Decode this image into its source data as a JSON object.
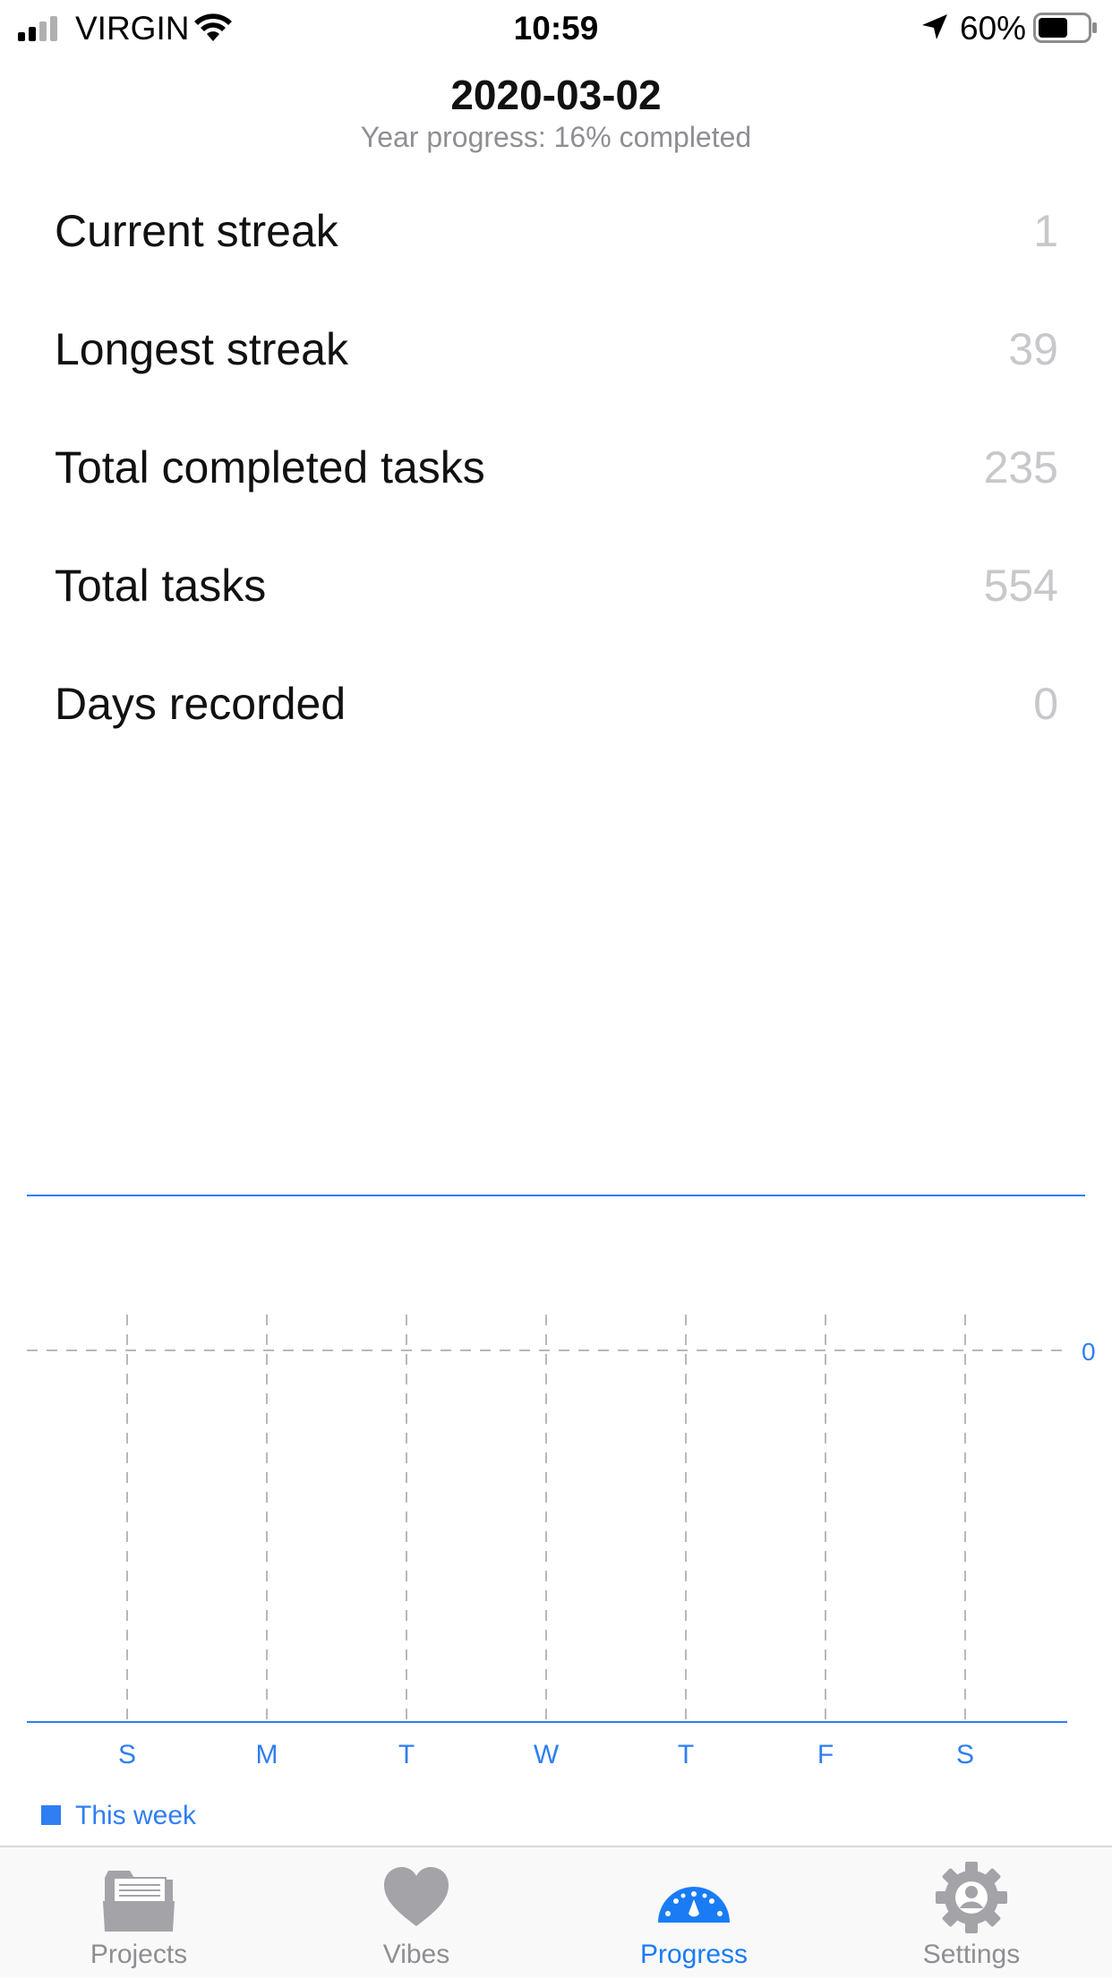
{
  "status_bar": {
    "carrier": "VIRGIN",
    "time": "10:59",
    "battery_percent": "60%",
    "battery_level": 0.6
  },
  "header": {
    "title": "2020-03-02",
    "subtitle": "Year progress: 16% completed"
  },
  "stats": [
    {
      "label": "Current streak",
      "value": "1"
    },
    {
      "label": "Longest streak",
      "value": "39"
    },
    {
      "label": "Total completed tasks",
      "value": "235"
    },
    {
      "label": "Total tasks",
      "value": "554"
    },
    {
      "label": "Days recorded",
      "value": "0"
    }
  ],
  "chart_data": {
    "type": "bar",
    "categories": [
      "S",
      "M",
      "T",
      "W",
      "T",
      "F",
      "S"
    ],
    "series": [
      {
        "name": "This week",
        "values": [
          0,
          0,
          0,
          0,
          0,
          0,
          0
        ]
      }
    ],
    "y_tick_labels": [
      "0"
    ],
    "title": "",
    "xlabel": "",
    "ylabel": "",
    "grid": true,
    "legend": "bottom-left",
    "color": "#2f7ef2"
  },
  "tab_bar": {
    "items": [
      {
        "label": "Projects",
        "icon": "folder-icon",
        "active": false
      },
      {
        "label": "Vibes",
        "icon": "heart-icon",
        "active": false
      },
      {
        "label": "Progress",
        "icon": "gauge-icon",
        "active": true
      },
      {
        "label": "Settings",
        "icon": "gear-icon",
        "active": false
      }
    ],
    "active_color": "#1a7cf5",
    "inactive_color": "#8e8e93"
  }
}
